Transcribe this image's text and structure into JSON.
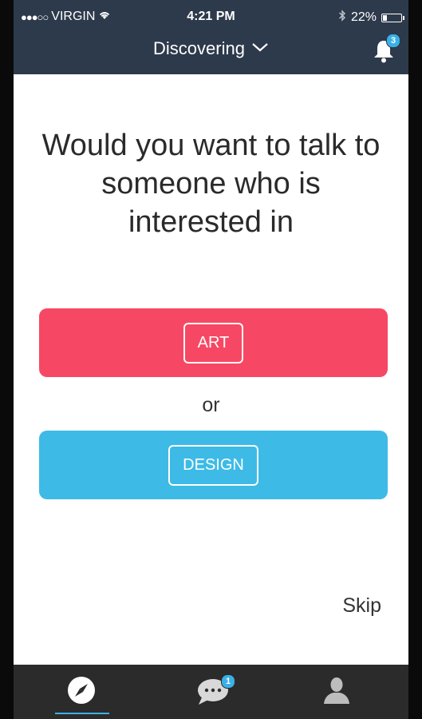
{
  "status_bar": {
    "carrier": "VIRGIN",
    "time": "4:21 PM",
    "battery": "22%",
    "battery_level": 0.22,
    "icons": [
      "signal-dots-icon",
      "wifi-icon",
      "bluetooth-icon",
      "battery-icon"
    ]
  },
  "nav": {
    "title": "Discovering",
    "dropdown_icon": "chevron-down-icon",
    "notifications_icon": "bell-icon",
    "notification_count": "3"
  },
  "content": {
    "question": "Would you want to talk to someone who is interested in",
    "option_a": "ART",
    "separator": "or",
    "option_b": "DESIGN",
    "skip": "Skip"
  },
  "tabbar": {
    "tabs": [
      {
        "name": "discover",
        "icon": "compass-icon",
        "active": true
      },
      {
        "name": "chat",
        "icon": "chat-bubble-icon",
        "badge": "1"
      },
      {
        "name": "profile",
        "icon": "user-icon"
      }
    ]
  },
  "colors": {
    "header_bg": "#2d3a4b",
    "art_card": "#f64864",
    "design_card": "#3dbbe6",
    "badge": "#3bb0e8",
    "tabbar_bg": "#2b2b2b"
  }
}
